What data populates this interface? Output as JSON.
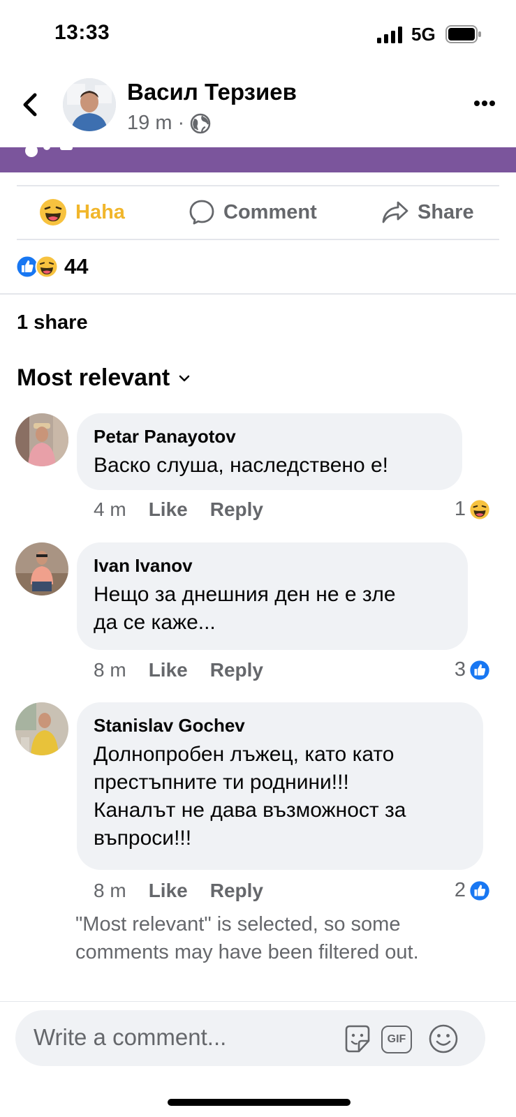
{
  "status_bar": {
    "time": "13:33",
    "network": "5G"
  },
  "post": {
    "author": "Васил Терзиев",
    "time_ago": "19 m",
    "separator": "·"
  },
  "actions": {
    "haha": "Haha",
    "comment": "Comment",
    "share": "Share"
  },
  "reactions": {
    "count": "44"
  },
  "shares": "1 share",
  "sort": {
    "label": "Most relevant"
  },
  "comments": [
    {
      "name": "Petar Panayotov",
      "text": "Васко слуша, наследствено е!",
      "time": "4 m",
      "like": "Like",
      "reply": "Reply",
      "reaction_count": "1",
      "reaction_type": "haha"
    },
    {
      "name": "Ivan Ivanov",
      "text_lines": [
        "Нещо за днешния ден не е зле",
        "да се каже..."
      ],
      "time": "8 m",
      "like": "Like",
      "reply": "Reply",
      "reaction_count": "3",
      "reaction_type": "like"
    },
    {
      "name": "Stanislav Gochev",
      "text_lines": [
        "Долнопробен лъжец, като като",
        "престъпните ти роднини!!!",
        "Каналът не дава възможност за",
        "въпроси!!!"
      ],
      "time": "8 m",
      "like": "Like",
      "reply": "Reply",
      "reaction_count": "2",
      "reaction_type": "like"
    }
  ],
  "filter_note": "\"Most relevant\" is selected, so some comments may have been filtered out.",
  "composer": {
    "placeholder": "Write a comment...",
    "gif_label": "GIF"
  },
  "colors": {
    "haha_yellow": "#f1b62b",
    "like_blue": "#1877f2",
    "purple_strip": "#7b559c",
    "secondary_text": "#65676b"
  }
}
